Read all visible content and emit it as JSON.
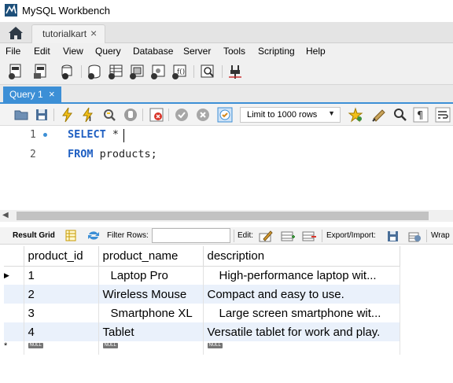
{
  "window": {
    "title": "MySQL Workbench"
  },
  "connection_tab": {
    "label": "tutorialkart",
    "close": "×"
  },
  "menu": [
    "File",
    "Edit",
    "View",
    "Query",
    "Database",
    "Server",
    "Tools",
    "Scripting",
    "Help"
  ],
  "query_tab": {
    "label": "Query 1",
    "close": "×"
  },
  "editor_toolbar": {
    "limit_label": "Limit to 1000 rows",
    "limit_arrow": "▼"
  },
  "editor": {
    "lines": [
      {
        "number": "1",
        "keyword": "SELECT",
        "rest": " *"
      },
      {
        "number": "2",
        "keyword": "FROM",
        "rest": " products;"
      }
    ]
  },
  "result_toolbar": {
    "result_grid": "Result Grid",
    "filter_rows": "Filter Rows:",
    "filter_value": "",
    "edit": "Edit:",
    "export_import": "Export/Import:",
    "wrap": "Wrap"
  },
  "grid": {
    "columns": [
      "product_id",
      "product_name",
      "description"
    ],
    "rows": [
      {
        "marker": "▶",
        "product_id": "1",
        "product_name": "Laptop Pro",
        "description": "High-performance laptop wit..."
      },
      {
        "marker": "",
        "product_id": "2",
        "product_name": "Wireless Mouse",
        "description": "Compact and easy to use."
      },
      {
        "marker": "",
        "product_id": "3",
        "product_name": "Smartphone XL",
        "description": "Large screen smartphone wit..."
      },
      {
        "marker": "",
        "product_id": "4",
        "product_name": "Tablet",
        "description": "Versatile tablet for work and play."
      }
    ],
    "new_row": {
      "marker": "*",
      "null_label": "NULL"
    }
  },
  "colors": {
    "accent": "#3c8fd6",
    "keyword": "#1f5fc2",
    "alt_row": "#eaf1fb"
  }
}
